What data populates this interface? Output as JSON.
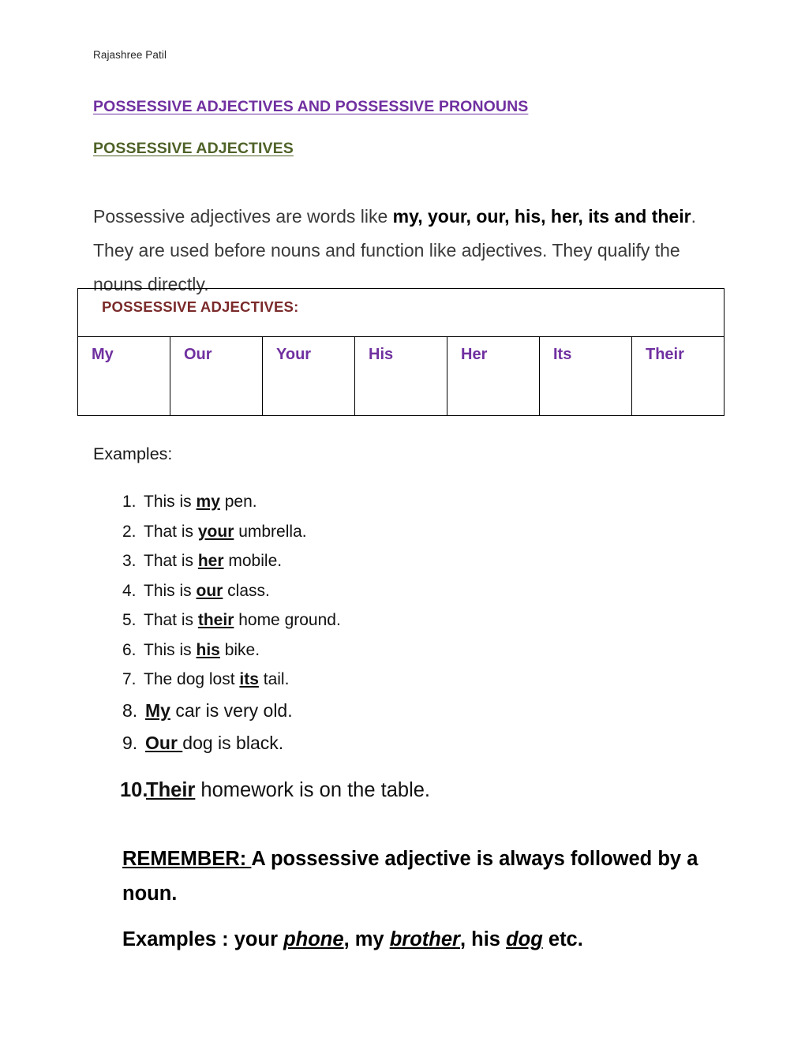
{
  "document": {
    "running_header": "Rajashree Patil",
    "title": "POSSESSIVE ADJECTIVES AND POSSESSIVE PRONOUNS",
    "subtitle": "POSSESSIVE  ADJECTIVES",
    "colors": {
      "title": "#7030a0",
      "subtitle": "#4f6228",
      "table_header": "#7b2a2a",
      "table_word": "#7030a0",
      "body_text": "#3a3a3a"
    }
  },
  "intro": {
    "part1": "Possessive adjectives are words like ",
    "bold1": "my, your, our, his, her, its and their",
    "part2": ". They are used before nouns and function like adjectives. They qualify the nouns directly."
  },
  "table": {
    "header": "POSSESSIVE  ADJECTIVES:",
    "words": [
      "My",
      "Our",
      "Your",
      "His",
      "Her",
      "Its",
      "Their"
    ]
  },
  "examples_label": "Examples:",
  "examples": [
    {
      "num": "1.",
      "pre": "This is ",
      "bold": "my",
      "post": " pen."
    },
    {
      "num": "2.",
      "pre": "That is ",
      "bold": "your",
      "post": " umbrella."
    },
    {
      "num": "3.",
      "pre": "That is ",
      "bold": "her",
      "post": " mobile."
    },
    {
      "num": "4.",
      "pre": "This is ",
      "bold": "our",
      "post": " class."
    },
    {
      "num": "5.",
      "pre": "That is ",
      "bold": "their",
      "post": " home ground."
    },
    {
      "num": "6.",
      "pre": "This is ",
      "bold": "his",
      "post": " bike."
    },
    {
      "num": "7.",
      "pre": "The dog lost ",
      "bold": "its",
      "post": " tail."
    },
    {
      "num": "8.",
      "pre": "",
      "bold": "My",
      "post": " car is very old."
    },
    {
      "num": "9.",
      "pre": "",
      "bold": "Our ",
      "post": "dog is black."
    },
    {
      "num": "10.",
      "pre": "",
      "bold": "Their",
      "post": " homework is on the table."
    }
  ],
  "remember": {
    "label": "REMEMBER: ",
    "text": "A possessive adjective is always followed by a noun."
  },
  "closing": {
    "label": "Examples : ",
    "w1_adj": "your ",
    "w1_noun": "phone",
    "sep1": ", ",
    "w2_adj": "my ",
    "w2_noun": "brother",
    "sep2": ", ",
    "w3_adj": "his ",
    "w3_noun": "dog",
    "tail": " etc."
  }
}
